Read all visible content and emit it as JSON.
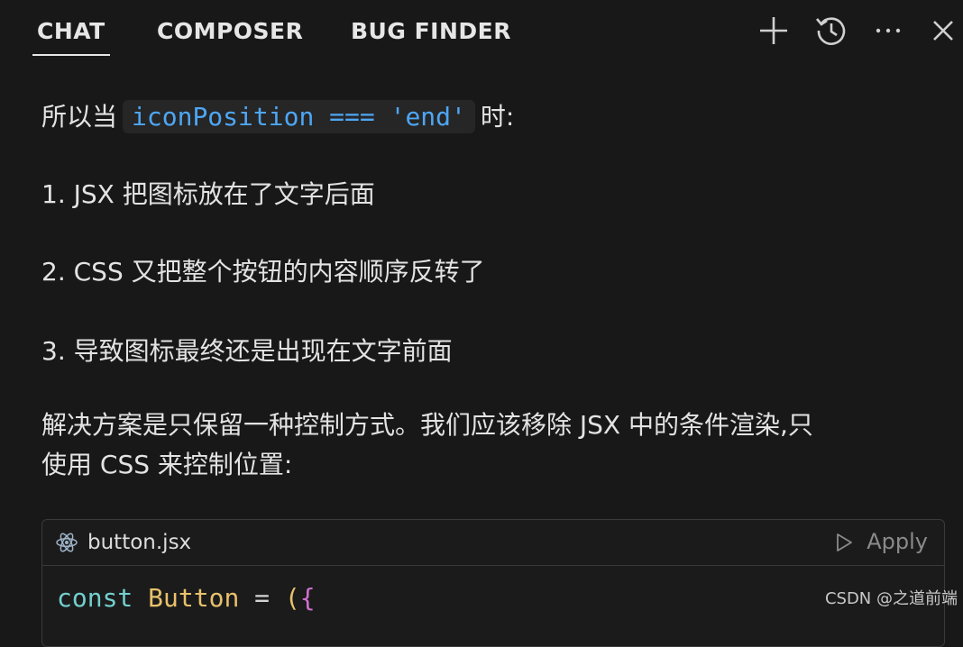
{
  "tabs": [
    {
      "label": "CHAT",
      "active": true
    },
    {
      "label": "COMPOSER",
      "active": false
    },
    {
      "label": "BUG FINDER",
      "active": false
    }
  ],
  "toolbar_icons": [
    "plus-icon",
    "history-icon",
    "more-icon",
    "close-icon"
  ],
  "message": {
    "intro_prefix": "所以当",
    "intro_code": "iconPosition === 'end'",
    "intro_suffix": "时:",
    "items": [
      "1. JSX 把图标放在了文字后面",
      "2. CSS 又把整个按钮的内容顺序反转了",
      "3. 导致图标最终还是出现在文字前面"
    ],
    "solution_line1": "解决方案是只保留一种控制方式。我们应该移除 JSX 中的条件渲染,只",
    "solution_line2": "使用 CSS 来控制位置:"
  },
  "code_block": {
    "filename": "button.jsx",
    "file_icon": "react-icon",
    "apply_label": "Apply",
    "code": {
      "keyword": "const",
      "name": "Button",
      "operator": "=",
      "paren": "(",
      "brace": "{"
    }
  },
  "watermark": "CSDN @之道前端",
  "colors": {
    "background": "#181818",
    "inline_code": "#4ea6f5",
    "keyword": "#73cfcf",
    "function_name": "#e7c16c",
    "brace": "#d070d0"
  }
}
